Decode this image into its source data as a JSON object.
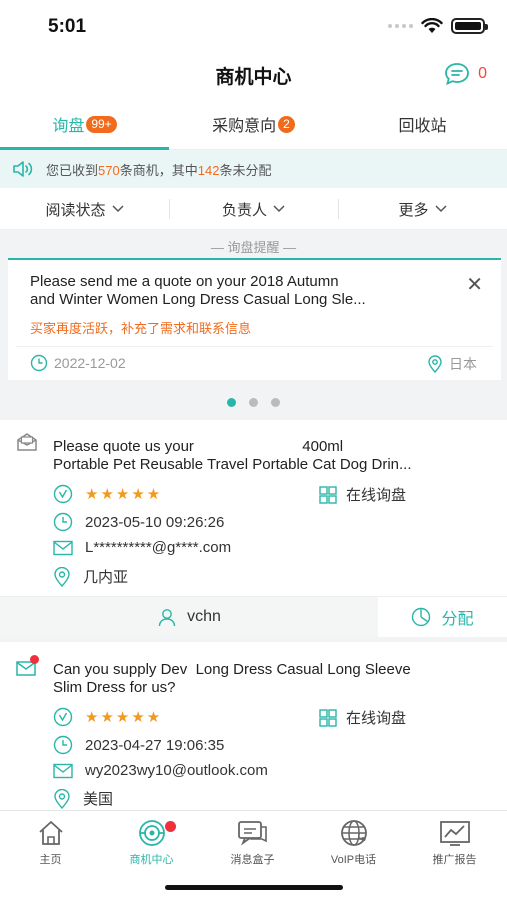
{
  "status": {
    "time": "5:01"
  },
  "header": {
    "title": "商机中心",
    "message_count": "0"
  },
  "tabs": [
    {
      "label": "询盘",
      "badge": "99+"
    },
    {
      "label": "采购意向",
      "badge": "2"
    },
    {
      "label": "回收站"
    }
  ],
  "notice": {
    "prefix": "您已收到",
    "total": "570",
    "mid": "条商机，其中",
    "unassigned": "142",
    "suffix": "条未分配"
  },
  "filters": {
    "read_status": "阅读状态",
    "owner": "负责人",
    "more": "更多"
  },
  "reminder": {
    "heading": "— 询盘提醒 —",
    "title_line1": "Please send me a quote on your 2018 Autumn",
    "title_line2": "and Winter Women Long Dress Casual Long Sle...",
    "subtitle": "买家再度活跃，补充了需求和联系信息",
    "date": "2022-12-02",
    "location": "日本",
    "pages": 3,
    "current_page": 1
  },
  "inquiries": [
    {
      "title_line1": "Please quote us your                          400ml",
      "title_line2": "Portable Pet Reusable Travel Portable Cat Dog Drin...",
      "stars": "★★★★★",
      "channel": "在线询盘",
      "time": "2023-05-10 09:26:26",
      "email": "L**********@g****.com",
      "location": "几内亚",
      "assignee": "vchn",
      "assign_label": "分配",
      "unread": false
    },
    {
      "title_line1": "Can you supply Dev  Long Dress Casual Long Sleeve",
      "title_line2": "Slim Dress for us?",
      "stars": "★★★★★",
      "channel": "在线询盘",
      "time": "2023-04-27 19:06:35",
      "email": "wy2023wy10@outlook.com",
      "location": "美国",
      "unread": true
    }
  ],
  "tabbar": [
    {
      "label": "主页",
      "icon": "home-icon"
    },
    {
      "label": "商机中心",
      "icon": "target-icon",
      "active": true
    },
    {
      "label": "消息盒子",
      "icon": "chat-icon"
    },
    {
      "label": "VoIP电话",
      "icon": "globe-phone-icon"
    },
    {
      "label": "推广报告",
      "icon": "report-icon"
    }
  ],
  "colors": {
    "accent": "#29b6a8",
    "orange": "#f26b1d",
    "red": "#f0313b"
  }
}
